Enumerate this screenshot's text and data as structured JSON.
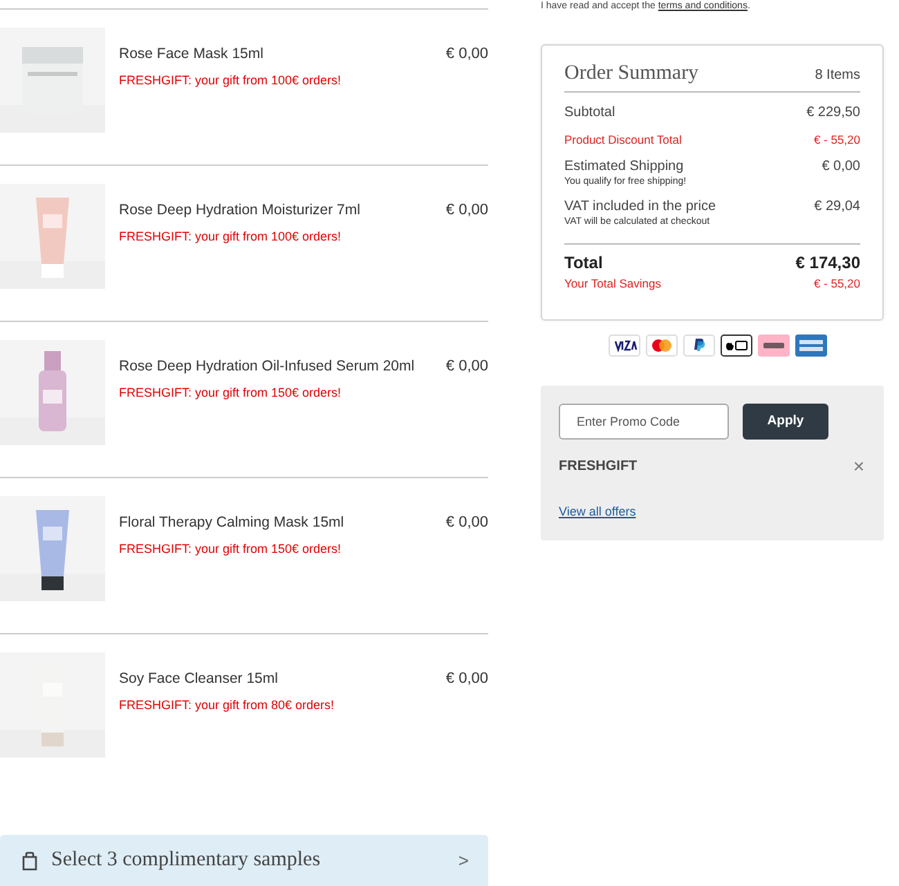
{
  "terms": {
    "text": "I have read and accept the",
    "link": "terms and conditions",
    "end": "."
  },
  "items": [
    {
      "name": "Rose Face Mask 15ml",
      "promo": "FRESHGIFT: your gift from 100€ orders!",
      "price": "€ 0,00"
    },
    {
      "name": "Rose Deep Hydration Moisturizer 7ml",
      "promo": "FRESHGIFT: your gift from 100€ orders!",
      "price": "€ 0,00"
    },
    {
      "name": "Rose Deep Hydration Oil-Infused Serum 20ml",
      "promo": "FRESHGIFT: your gift from 150€ orders!",
      "price": "€ 0,00"
    },
    {
      "name": "Floral Therapy Calming Mask 15ml",
      "promo": "FRESHGIFT: your gift from 150€ orders!",
      "price": "€ 0,00"
    },
    {
      "name": "Soy Face Cleanser 15ml",
      "promo": "FRESHGIFT: your gift from 80€ orders!",
      "price": "€ 0,00"
    }
  ],
  "samples_banner": {
    "label": "Select 3 complimentary samples",
    "chevron": ">"
  },
  "order_summary": {
    "title": "Order Summary",
    "count": "8 Items",
    "lines": [
      {
        "kind": "normal",
        "label": "Subtotal",
        "value": "€ 229,50"
      },
      {
        "kind": "discount",
        "label": "Product Discount Total",
        "value": "€ - 55,20"
      },
      {
        "kind": "normal",
        "label": "Estimated Shipping",
        "note": "You qualify for free shipping!",
        "value": "€ 0,00"
      },
      {
        "kind": "normal",
        "label": "VAT included in the price",
        "note": "VAT will be calculated at checkout",
        "value": "€ 29,04"
      }
    ],
    "total": {
      "label": "Total",
      "value": "€ 174,30"
    },
    "savings": {
      "label": "Your Total Savings",
      "value": "€ - 55,20"
    }
  },
  "payment_methods": [
    {
      "kind": "visa"
    },
    {
      "kind": "mastercard"
    },
    {
      "kind": "paypal"
    },
    {
      "kind": "applepay"
    },
    {
      "kind": "klarna"
    },
    {
      "kind": "amex"
    }
  ],
  "promo": {
    "placeholder": "Enter Promo Code",
    "apply": "Apply",
    "applied_code": "FRESHGIFT",
    "remove": "×",
    "offers_link": "View all offers"
  }
}
